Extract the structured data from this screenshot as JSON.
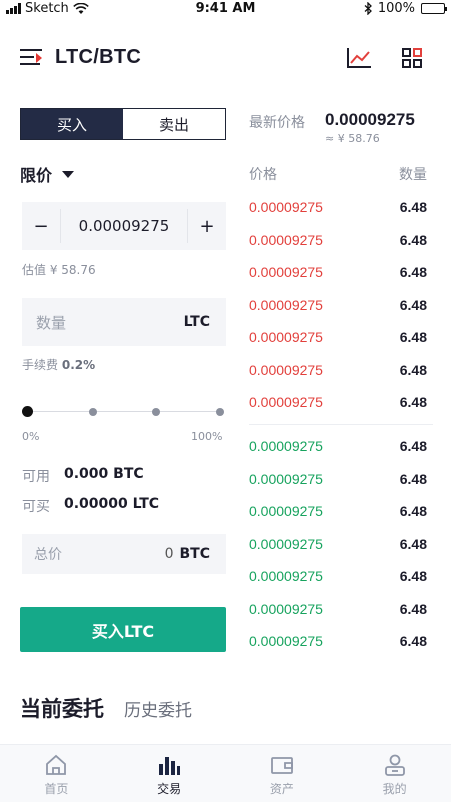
{
  "status_bar": {
    "carrier": "Sketch",
    "time": "9:41 AM",
    "battery": "100%",
    "battery_level": 1.0
  },
  "header": {
    "pair": "LTC/BTC",
    "menu_icon": "menu-icon",
    "chart_icon": "line-chart-icon",
    "grid_icon": "grid-icon"
  },
  "trade": {
    "tabs": [
      "买入",
      "卖出"
    ],
    "active_tab": 0,
    "order_type": "限价",
    "price": {
      "minus": "−",
      "value": "0.00009275",
      "plus": "+"
    },
    "estimate": "估值 ¥ 58.76",
    "quantity": {
      "placeholder": "数量",
      "unit": "LTC"
    },
    "fee_label": "手续费",
    "fee_value": "0.2%",
    "slider": {
      "level": 0,
      "min_label": "0%",
      "max_label": "100%"
    },
    "available": {
      "label": "可用",
      "value": "0.000 BTC"
    },
    "can_buy": {
      "label": "可买",
      "value": "0.00000 LTC"
    },
    "total": {
      "placeholder": "总价",
      "value": "0",
      "unit": "BTC"
    },
    "submit_label": "买入LTC"
  },
  "market": {
    "latest_label": "最新价格",
    "latest_price": "0.00009275",
    "latest_cny": "≈ ¥ 58.76",
    "col_price": "价格",
    "col_qty": "数量",
    "colors": {
      "sell": "#e2403c",
      "buy": "#17a35e"
    },
    "asks": [
      {
        "price": "0.00009275",
        "qty": "6.48"
      },
      {
        "price": "0.00009275",
        "qty": "6.48"
      },
      {
        "price": "0.00009275",
        "qty": "6.48"
      },
      {
        "price": "0.00009275",
        "qty": "6.48"
      },
      {
        "price": "0.00009275",
        "qty": "6.48"
      },
      {
        "price": "0.00009275",
        "qty": "6.48"
      },
      {
        "price": "0.00009275",
        "qty": "6.48"
      }
    ],
    "bids": [
      {
        "price": "0.00009275",
        "qty": "6.48"
      },
      {
        "price": "0.00009275",
        "qty": "6.48"
      },
      {
        "price": "0.00009275",
        "qty": "6.48"
      },
      {
        "price": "0.00009275",
        "qty": "6.48"
      },
      {
        "price": "0.00009275",
        "qty": "6.48"
      },
      {
        "price": "0.00009275",
        "qty": "6.48"
      },
      {
        "price": "0.00009275",
        "qty": "6.48"
      }
    ]
  },
  "orders": {
    "current": "当前委托",
    "history": "历史委托"
  },
  "nav": {
    "items": [
      {
        "label": "首页",
        "icon": "home-icon"
      },
      {
        "label": "交易",
        "icon": "bar-chart-icon"
      },
      {
        "label": "资产",
        "icon": "wallet-icon"
      },
      {
        "label": "我的",
        "icon": "user-icon"
      }
    ],
    "active": 1
  }
}
